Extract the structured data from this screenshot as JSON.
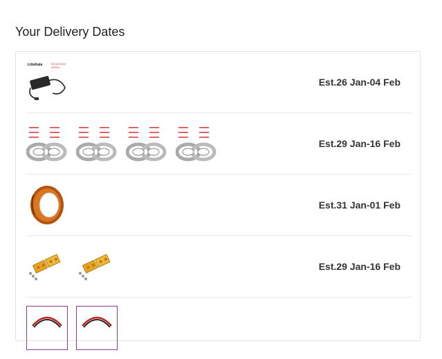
{
  "page": {
    "title": "Your Delivery Dates"
  },
  "shipments": [
    {
      "date": "Est.26 Jan-04 Feb",
      "thumb_count": 1,
      "image": "power-adapter",
      "brand_text": "LiitoKala",
      "spec_lines": [
        "5V/12V/24V",
        "HP4H/...",
        "..."
      ]
    },
    {
      "date": "Est.29 Jan-16 Feb",
      "thumb_count": 4,
      "image": "nickel-strip-rolls"
    },
    {
      "date": "Est.31 Jan-01 Feb",
      "thumb_count": 1,
      "image": "kapton-tape-roll"
    },
    {
      "date": "Est.29 Jan-16 Feb",
      "thumb_count": 2,
      "image": "battery-holder-brackets"
    },
    {
      "date": "",
      "thumb_count": 2,
      "image": "cable-wire"
    }
  ],
  "colors": {
    "accent_border": "#8a3a8f",
    "nickel_text_red": "#d33"
  }
}
